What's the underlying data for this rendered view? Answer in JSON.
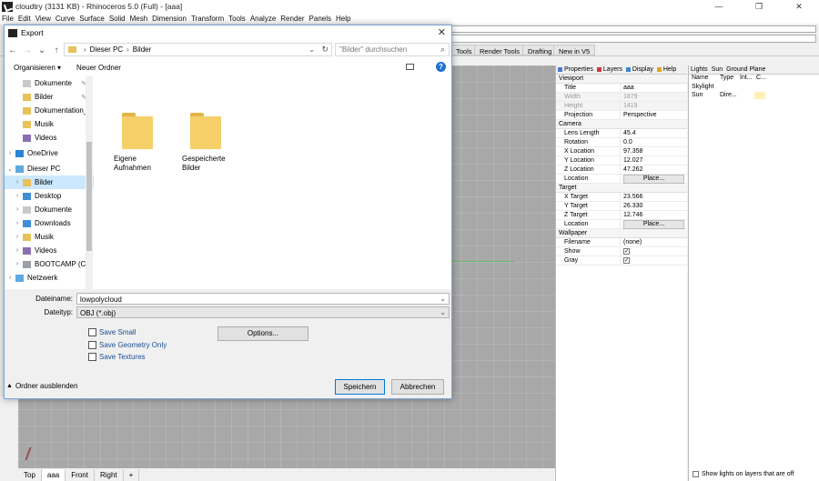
{
  "app": {
    "title": "cloudtry (3131 KB) - Rhinoceros 5.0 (Full) - [aaa]",
    "window_controls": [
      "—",
      "❐",
      "✕"
    ]
  },
  "menu": [
    "File",
    "Edit",
    "View",
    "Curve",
    "Surface",
    "Solid",
    "Mesh",
    "Dimension",
    "Transform",
    "Tools",
    "Analyze",
    "Render",
    "Panels",
    "Help"
  ],
  "toolbar_tabs": [
    "Tools",
    "Render Tools",
    "Drafting",
    "New in V5"
  ],
  "viewport_tabs": [
    "Top",
    "aaa",
    "Front",
    "Right",
    "+"
  ],
  "properties": {
    "tabs": [
      "Properties",
      "Layers",
      "Display",
      "Help"
    ],
    "sections": {
      "viewport": "Viewport",
      "camera": "Camera",
      "target": "Target",
      "wallpaper": "Wallpaper"
    },
    "viewport_rows": [
      {
        "k": "Title",
        "v": "aaa"
      },
      {
        "k": "Width",
        "v": "1879"
      },
      {
        "k": "Height",
        "v": "1419"
      },
      {
        "k": "Projection",
        "v": "Perspective"
      }
    ],
    "camera_rows": [
      {
        "k": "Lens Length",
        "v": "45.4"
      },
      {
        "k": "Rotation",
        "v": "0.0"
      },
      {
        "k": "X Location",
        "v": "97.358"
      },
      {
        "k": "Y Location",
        "v": "12.027"
      },
      {
        "k": "Z Location",
        "v": "47.262"
      },
      {
        "k": "Location",
        "v": "Place..."
      }
    ],
    "target_rows": [
      {
        "k": "X Target",
        "v": "23.566"
      },
      {
        "k": "Y Target",
        "v": "26.330"
      },
      {
        "k": "Z Target",
        "v": "12.746"
      },
      {
        "k": "Location",
        "v": "Place..."
      }
    ],
    "wallpaper_rows": [
      {
        "k": "Filename",
        "v": "(none)"
      },
      {
        "k": "Show",
        "v": "✓"
      },
      {
        "k": "Gray",
        "v": "✓"
      }
    ]
  },
  "lights": {
    "tabs": [
      "Lights",
      "Sun",
      "Ground Plane"
    ],
    "columns": [
      "Name",
      "Type",
      "Int...",
      "C..."
    ],
    "rows": [
      {
        "name": "Skylight",
        "type": ""
      },
      {
        "name": "Sun",
        "type": "Dire..."
      }
    ],
    "footer": "Show lights on layers that are off"
  },
  "dialog": {
    "title": "Export",
    "path": [
      "Dieser PC",
      "Bilder"
    ],
    "search_placeholder": "\"Bilder\" durchsuchen",
    "organize": "Organisieren ▾",
    "new_folder": "Neuer Ordner",
    "tree": [
      {
        "label": "Dokumente",
        "pinned": true,
        "indent": 1
      },
      {
        "label": "Bilder",
        "pinned": true,
        "indent": 1
      },
      {
        "label": "Dokumentation_",
        "pinned": false,
        "indent": 1
      },
      {
        "label": "Musik",
        "pinned": false,
        "indent": 1
      },
      {
        "label": "Videos",
        "pinned": false,
        "indent": 1
      },
      {
        "label": "OneDrive",
        "pinned": false,
        "indent": 0
      },
      {
        "label": "Dieser PC",
        "pinned": false,
        "indent": 0
      },
      {
        "label": "Bilder",
        "pinned": false,
        "indent": 1,
        "selected": true
      },
      {
        "label": "Desktop",
        "pinned": false,
        "indent": 1
      },
      {
        "label": "Dokumente",
        "pinned": false,
        "indent": 1
      },
      {
        "label": "Downloads",
        "pinned": false,
        "indent": 1
      },
      {
        "label": "Musik",
        "pinned": false,
        "indent": 1
      },
      {
        "label": "Videos",
        "pinned": false,
        "indent": 1
      },
      {
        "label": "BOOTCAMP (C:)",
        "pinned": false,
        "indent": 1
      },
      {
        "label": "Netzwerk",
        "pinned": false,
        "indent": 0
      }
    ],
    "files": [
      {
        "label": "Eigene Aufnahmen"
      },
      {
        "label": "Gespeicherte Bilder"
      }
    ],
    "filename_label": "Dateiname:",
    "filename_value": "lowpolycloud",
    "filetype_label": "Dateityp:",
    "filetype_value": "OBJ (*.obj)",
    "options": [
      "Save Small",
      "Save Geometry Only",
      "Save Textures"
    ],
    "options_button": "Options...",
    "hide_folders": "Ordner ausblenden",
    "save": "Speichern",
    "cancel": "Abbrechen"
  }
}
